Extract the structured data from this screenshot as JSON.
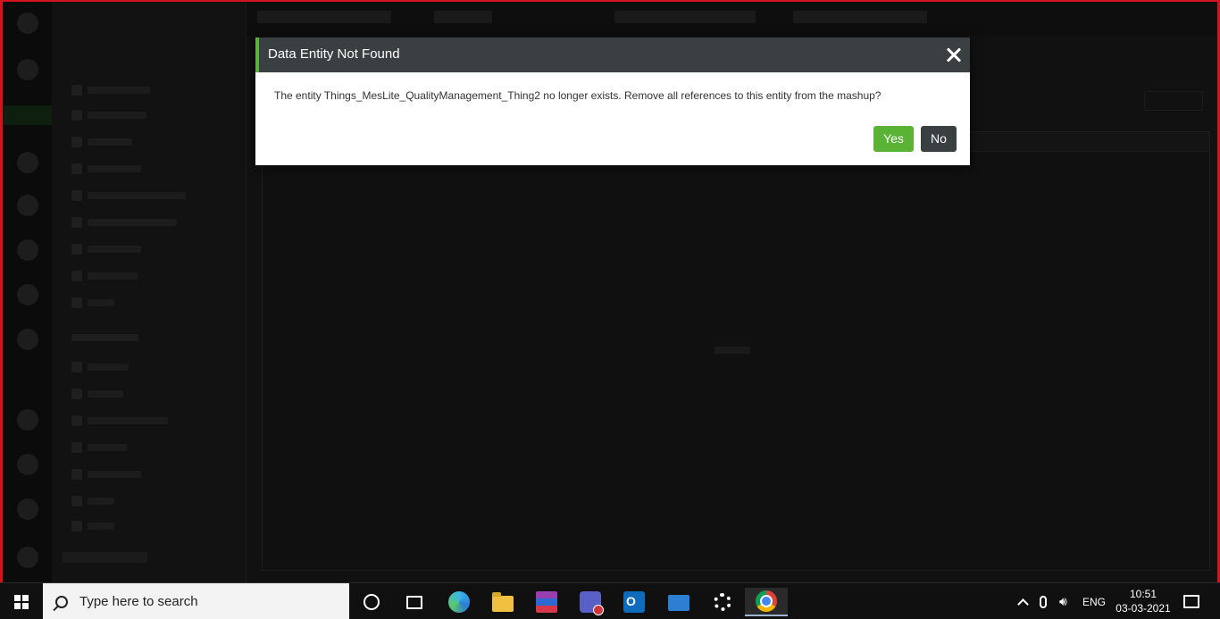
{
  "modal": {
    "title": "Data Entity Not Found",
    "message": "The entity Things_MesLite_QualityManagement_Thing2 no longer exists. Remove all references to this entity from the mashup?",
    "yes_label": "Yes",
    "no_label": "No",
    "close_icon": "close-icon"
  },
  "taskbar": {
    "search_placeholder": "Type here to search",
    "apps": [
      "cortana-icon",
      "task-view-icon",
      "edge-icon",
      "file-explorer-icon",
      "winrar-icon",
      "teams-icon",
      "outlook-icon",
      "remote-desktop-icon",
      "settings-icon",
      "chrome-icon"
    ],
    "language": "ENG",
    "time": "10:51",
    "date": "03-03-2021"
  },
  "colors": {
    "frame": "#d4141c",
    "modal_header": "#3a3f41",
    "modal_accent": "#5db040",
    "yes_button": "#5ab335",
    "no_button": "#3a3f41"
  }
}
